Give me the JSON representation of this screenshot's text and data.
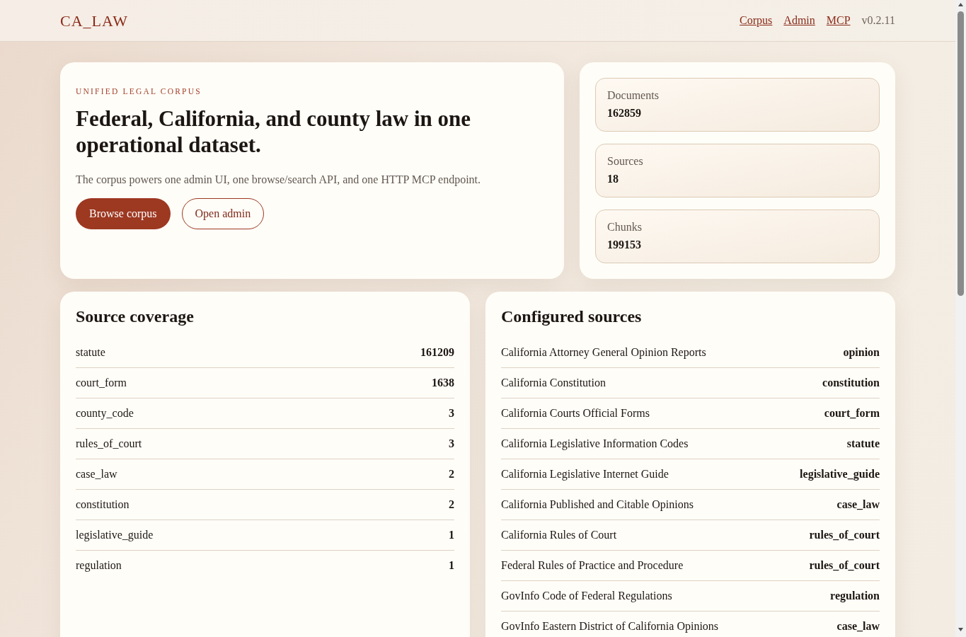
{
  "header": {
    "logo": "CA_LAW",
    "nav": [
      {
        "label": "Corpus"
      },
      {
        "label": "Admin"
      },
      {
        "label": "MCP"
      }
    ],
    "version": "v0.2.11"
  },
  "hero": {
    "eyebrow": "UNIFIED LEGAL CORPUS",
    "title": "Federal, California, and county law in one operational dataset.",
    "description": "The corpus powers one admin UI, one browse/search API, and one HTTP MCP endpoint.",
    "actions": [
      {
        "label": "Browse corpus",
        "kind": "primary"
      },
      {
        "label": "Open admin",
        "kind": "secondary"
      }
    ]
  },
  "stats": [
    {
      "label": "Documents",
      "value": "162859"
    },
    {
      "label": "Sources",
      "value": "18"
    },
    {
      "label": "Chunks",
      "value": "199153"
    }
  ],
  "source_coverage": {
    "title": "Source coverage",
    "rows": [
      {
        "type": "statute",
        "count": "161209"
      },
      {
        "type": "court_form",
        "count": "1638"
      },
      {
        "type": "county_code",
        "count": "3"
      },
      {
        "type": "rules_of_court",
        "count": "3"
      },
      {
        "type": "case_law",
        "count": "2"
      },
      {
        "type": "constitution",
        "count": "2"
      },
      {
        "type": "legislative_guide",
        "count": "1"
      },
      {
        "type": "regulation",
        "count": "1"
      }
    ]
  },
  "configured_sources": {
    "title": "Configured sources",
    "rows": [
      {
        "name": "California Attorney General Opinion Reports",
        "type": "opinion"
      },
      {
        "name": "California Constitution",
        "type": "constitution"
      },
      {
        "name": "California Courts Official Forms",
        "type": "court_form"
      },
      {
        "name": "California Legislative Information Codes",
        "type": "statute"
      },
      {
        "name": "California Legislative Internet Guide",
        "type": "legislative_guide"
      },
      {
        "name": "California Published and Citable Opinions",
        "type": "case_law"
      },
      {
        "name": "California Rules of Court",
        "type": "rules_of_court"
      },
      {
        "name": "Federal Rules of Practice and Procedure",
        "type": "rules_of_court"
      },
      {
        "name": "GovInfo Code of Federal Regulations",
        "type": "regulation"
      },
      {
        "name": "GovInfo Eastern District of California Opinions",
        "type": "case_law"
      }
    ]
  }
}
